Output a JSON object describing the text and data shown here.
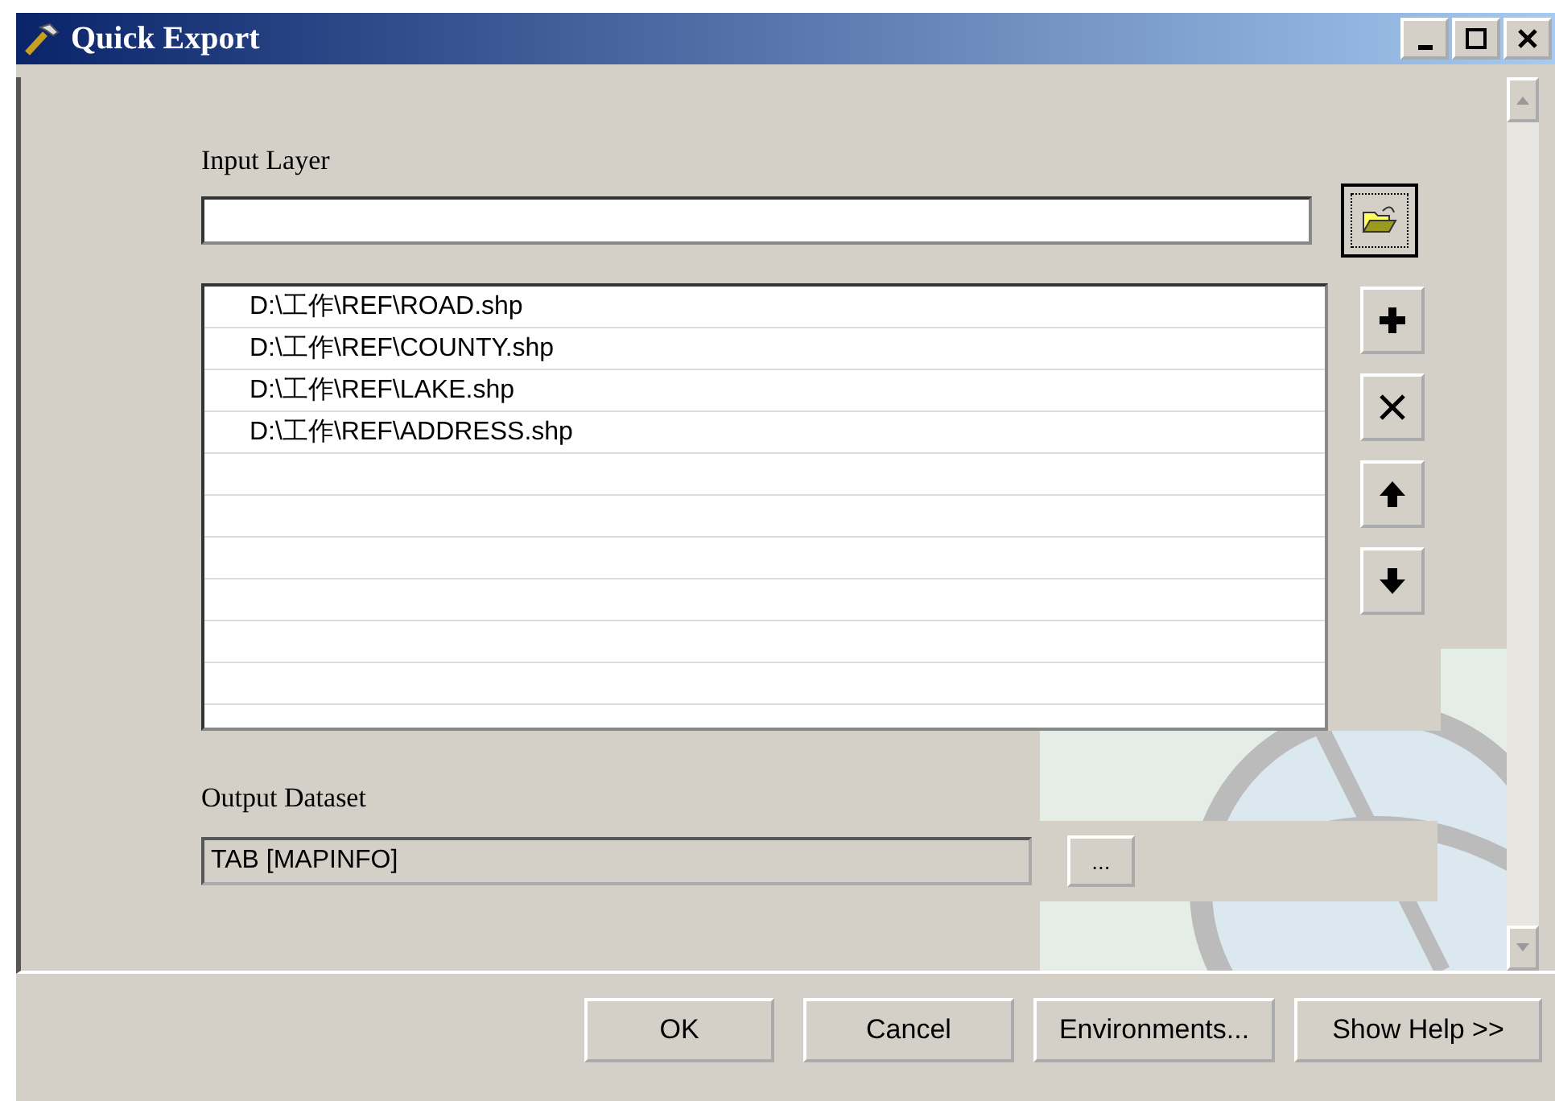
{
  "window": {
    "title": "Quick Export"
  },
  "input_layer": {
    "label": "Input Layer"
  },
  "layers": [
    {
      "path": "D:\\工作\\REF\\ROAD.shp"
    },
    {
      "path": "D:\\工作\\REF\\COUNTY.shp"
    },
    {
      "path": "D:\\工作\\REF\\LAKE.shp"
    },
    {
      "path": "D:\\工作\\REF\\ADDRESS.shp"
    }
  ],
  "output_dataset": {
    "label": "Output Dataset",
    "value": "TAB [MAPINFO]",
    "browse": "..."
  },
  "buttons": [
    {
      "label": "OK"
    },
    {
      "label": "Cancel"
    },
    {
      "label": "Environments..."
    },
    {
      "label": "Show Help >>"
    }
  ]
}
